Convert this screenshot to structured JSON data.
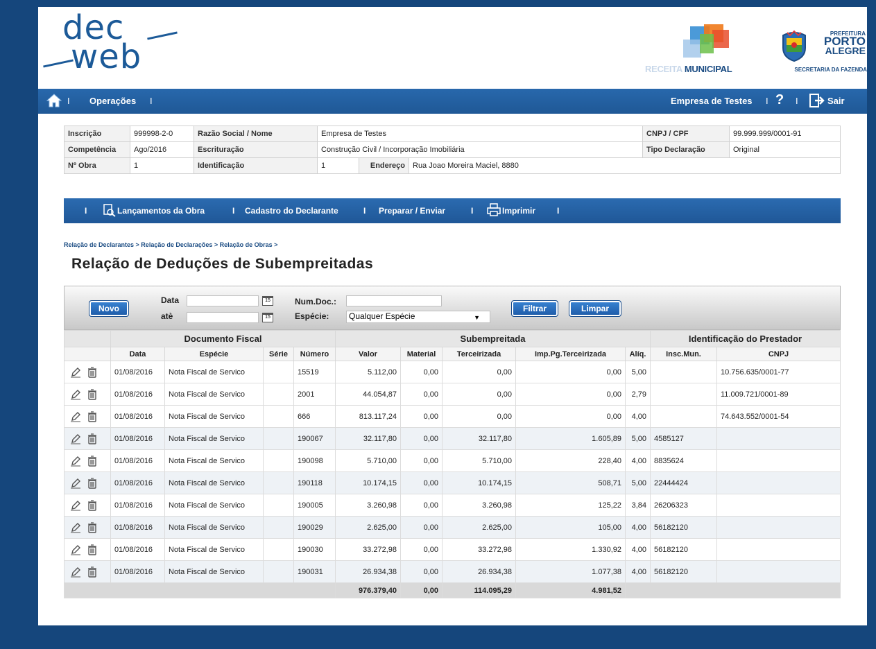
{
  "header": {
    "logo_text_1": "dec",
    "logo_text_2": "web",
    "receita_1": "RECEITA",
    "receita_2": "MUNICIPAL",
    "poa_1": "PREFEITURA",
    "poa_2": "PORTO",
    "poa_3": "ALEGRE",
    "poa_sub": "SECRETARIA DA FAZENDA"
  },
  "topnav": {
    "operacoes": "Operações",
    "empresa": "Empresa de Testes",
    "help": "?",
    "sair": "Sair",
    "sep": "I"
  },
  "info": {
    "inscricao_label": "Inscrição",
    "inscricao": "999998-2-0",
    "razao_label": "Razão Social / Nome",
    "razao": "Empresa de Testes",
    "cnpj_label": "CNPJ / CPF",
    "cnpj": "99.999.999/0001-91",
    "competencia_label": "Competência",
    "competencia": "Ago/2016",
    "escrituracao_label": "Escrituração",
    "escrituracao": "Construção Civil / Incorporação Imobiliária",
    "tipo_label": "Tipo Declaração",
    "tipo": "Original",
    "obra_label": "Nº Obra",
    "obra": "1",
    "identificacao_label": "Identificação",
    "identificacao": "1",
    "endereco_label": "Endereço",
    "endereco": "Rua Joao Moreira Maciel, 8880"
  },
  "subnav": {
    "lancamentos": "Lançamentos da Obra",
    "cadastro": "Cadastro do Declarante",
    "preparar": "Preparar / Enviar",
    "imprimir": "Imprimir"
  },
  "breadcrumb": "Relação de Declarantes > Relação de Declarações > Relação de Obras >",
  "page_title": "Relação de Deduções de Subempreitadas",
  "filter": {
    "novo": "Novo",
    "data_label": "Data",
    "ate_label": "atè",
    "numdoc_label": "Num.Doc.:",
    "especie_label": "Espécie:",
    "especie_value": "Qualquer Espécie",
    "filtrar": "Filtrar",
    "limpar": "Limpar",
    "cal": "15"
  },
  "grid": {
    "groups": [
      "Documento Fiscal",
      "Subempreitada",
      "Identificação do Prestador"
    ],
    "columns": [
      "Data",
      "Espécie",
      "Série",
      "Número",
      "Valor",
      "Material",
      "Terceirizada",
      "Imp.Pg.Terceirizada",
      "Alíq.",
      "Insc.Mun.",
      "CNPJ"
    ],
    "rows": [
      [
        "01/08/2016",
        "Nota Fiscal de Servico",
        "",
        "15519",
        "5.112,00",
        "0,00",
        "0,00",
        "0,00",
        "5,00",
        "",
        "10.756.635/0001-77"
      ],
      [
        "01/08/2016",
        "Nota Fiscal de Servico",
        "",
        "2001",
        "44.054,87",
        "0,00",
        "0,00",
        "0,00",
        "2,79",
        "",
        "11.009.721/0001-89"
      ],
      [
        "01/08/2016",
        "Nota Fiscal de Servico",
        "",
        "666",
        "813.117,24",
        "0,00",
        "0,00",
        "0,00",
        "4,00",
        "",
        "74.643.552/0001-54"
      ],
      [
        "01/08/2016",
        "Nota Fiscal de Servico",
        "",
        "190067",
        "32.117,80",
        "0,00",
        "32.117,80",
        "1.605,89",
        "5,00",
        "4585127",
        ""
      ],
      [
        "01/08/2016",
        "Nota Fiscal de Servico",
        "",
        "190098",
        "5.710,00",
        "0,00",
        "5.710,00",
        "228,40",
        "4,00",
        "8835624",
        ""
      ],
      [
        "01/08/2016",
        "Nota Fiscal de Servico",
        "",
        "190118",
        "10.174,15",
        "0,00",
        "10.174,15",
        "508,71",
        "5,00",
        "22444424",
        ""
      ],
      [
        "01/08/2016",
        "Nota Fiscal de Servico",
        "",
        "190005",
        "3.260,98",
        "0,00",
        "3.260,98",
        "125,22",
        "3,84",
        "26206323",
        ""
      ],
      [
        "01/08/2016",
        "Nota Fiscal de Servico",
        "",
        "190029",
        "2.625,00",
        "0,00",
        "2.625,00",
        "105,00",
        "4,00",
        "56182120",
        ""
      ],
      [
        "01/08/2016",
        "Nota Fiscal de Servico",
        "",
        "190030",
        "33.272,98",
        "0,00",
        "33.272,98",
        "1.330,92",
        "4,00",
        "56182120",
        ""
      ],
      [
        "01/08/2016",
        "Nota Fiscal de Servico",
        "",
        "190031",
        "26.934,38",
        "0,00",
        "26.934,38",
        "1.077,38",
        "4,00",
        "56182120",
        ""
      ]
    ],
    "totals": {
      "valor": "976.379,40",
      "material": "0,00",
      "terceirizada": "114.095,29",
      "imp": "4.981,52"
    }
  },
  "colors": {
    "brand_blue": "#1f5896",
    "button_blue": "#2b6fc0",
    "background": "#15467c"
  }
}
